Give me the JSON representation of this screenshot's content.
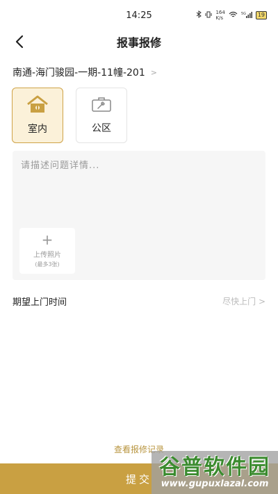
{
  "status_bar": {
    "time": "14:25",
    "network_speed_value": "164",
    "network_speed_unit": "K/s",
    "signal_label": "5G",
    "battery": "19"
  },
  "header": {
    "title": "报事报修"
  },
  "address": {
    "text": "南通-海门骏园-一期-11幢-201",
    "arrow": ">"
  },
  "categories": [
    {
      "label": "室内",
      "icon": "house-wrench-icon",
      "selected": true
    },
    {
      "label": "公区",
      "icon": "toolbox-icon",
      "selected": false
    }
  ],
  "description": {
    "placeholder": "请描述问题详情..."
  },
  "upload": {
    "label": "上传照片",
    "hint": "(最多3张)"
  },
  "visit_time": {
    "label": "期望上门时间",
    "value": "尽快上门 >"
  },
  "records_link": "查看报修记录",
  "submit": {
    "label": "提交"
  },
  "watermark": {
    "main": "谷普软件园",
    "sub": "www.gupuxlazal.com"
  },
  "colors": {
    "accent": "#c9a042",
    "selected_bg": "#fbf1d9"
  }
}
